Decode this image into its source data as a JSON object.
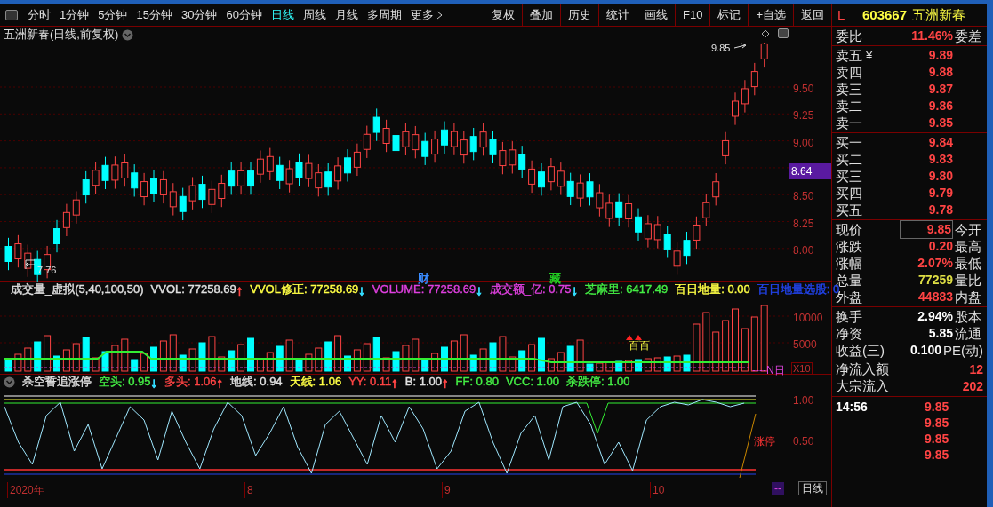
{
  "toolbar": {
    "periods": [
      {
        "label": "分时",
        "selected": false
      },
      {
        "label": "1分钟",
        "selected": false
      },
      {
        "label": "5分钟",
        "selected": false
      },
      {
        "label": "15分钟",
        "selected": false
      },
      {
        "label": "30分钟",
        "selected": false
      },
      {
        "label": "60分钟",
        "selected": false
      },
      {
        "label": "日线",
        "selected": true
      },
      {
        "label": "周线",
        "selected": false
      },
      {
        "label": "月线",
        "selected": false
      },
      {
        "label": "多周期",
        "selected": false
      }
    ],
    "more": "更多",
    "buttons": [
      "复权",
      "叠加",
      "历史",
      "统计",
      "画线",
      "F10",
      "标记",
      "+自选",
      "返回"
    ]
  },
  "main_chart": {
    "title": "五洲新春(日线,前复权)",
    "price_labels": [
      "9.50",
      "9.25",
      "9.00",
      "8.50",
      "8.25",
      "8.00"
    ],
    "current_price": "8.64",
    "high_marker": "9.85",
    "low_marker": "7.76",
    "signals": [
      {
        "text": "财",
        "color": "#3a8cff"
      },
      {
        "text": "藏",
        "color": "#22cc22"
      }
    ]
  },
  "volume_panel": {
    "legend": [
      {
        "text": "成交量_虚拟(5,40,100,50)",
        "color": "#e0e0e0"
      },
      {
        "text": "VVOL: 77258.69",
        "color": "#e0e0e0",
        "arrow": {
          "text": "↑",
          "color": "#ff4444"
        }
      },
      {
        "text": "VVOL修正: 77258.69",
        "color": "#ffff44",
        "arrow": {
          "text": "↓",
          "color": "#33ddff"
        }
      },
      {
        "text": "VOLUME: 77258.69",
        "color": "#e040e0",
        "arrow": {
          "text": "↓",
          "color": "#33ddff"
        }
      },
      {
        "text": "成交额_亿: 0.75",
        "color": "#e040e0",
        "arrow": {
          "text": "↓",
          "color": "#33ddff"
        }
      },
      {
        "text": "芝麻里: 6417.49",
        "color": "#44ee44"
      },
      {
        "text": "百日地量: 0.00",
        "color": "#ffff44"
      },
      {
        "text": "百日地量选股: 0",
        "color": "#2244ee"
      }
    ],
    "axis_labels": [
      "10000",
      "5000"
    ],
    "bottom_mark": "百百",
    "line_label": "----N日",
    "scale_label": "X10"
  },
  "indicator_panel": {
    "legend": [
      {
        "text": "杀空誓追涨停",
        "color": "#e0e0e0"
      },
      {
        "text": "空头: 0.95",
        "color": "#44ee44",
        "arrow": {
          "text": "↓",
          "color": "#33ddff"
        }
      },
      {
        "text": "多头: 1.06",
        "color": "#ff4444",
        "arrow": {
          "text": "↑",
          "color": "#ff4444"
        }
      },
      {
        "text": "地线: 0.94",
        "color": "#e0e0e0"
      },
      {
        "text": "天线: 1.06",
        "color": "#ffff44"
      },
      {
        "text": "YY: 0.11",
        "color": "#ff4444",
        "arrow": {
          "text": "↑",
          "color": "#ff4444"
        }
      },
      {
        "text": "B: 1.00",
        "color": "#e0e0e0",
        "arrow": {
          "text": "↑",
          "color": "#ff4444"
        }
      },
      {
        "text": "FF: 0.80",
        "color": "#44ee44"
      },
      {
        "text": "VCC: 1.00",
        "color": "#44ee44"
      },
      {
        "text": "杀跌停: 1.00",
        "color": "#44ee44"
      }
    ],
    "axis_labels": [
      "1.00",
      "0.50"
    ],
    "signal_label": "涨停"
  },
  "date_axis": {
    "labels": [
      "2020年",
      "8",
      "9",
      "10"
    ],
    "corner_button": "--",
    "period_tab": "日线"
  },
  "quote_panel": {
    "market": "L",
    "code": "603667",
    "name": "五洲新春",
    "ratio": {
      "label": "委比",
      "value": "11.46%",
      "right": "委差"
    },
    "sells": [
      {
        "label": "卖五",
        "tag": "¥",
        "price": "9.89"
      },
      {
        "label": "卖四",
        "price": "9.88"
      },
      {
        "label": "卖三",
        "price": "9.87"
      },
      {
        "label": "卖二",
        "price": "9.86"
      },
      {
        "label": "卖一",
        "price": "9.85"
      }
    ],
    "buys": [
      {
        "label": "买一",
        "price": "9.84"
      },
      {
        "label": "买二",
        "price": "9.83"
      },
      {
        "label": "买三",
        "price": "9.80"
      },
      {
        "label": "买四",
        "price": "9.79"
      },
      {
        "label": "买五",
        "price": "9.78"
      }
    ],
    "stats": [
      {
        "label": "现价",
        "value": "9.85",
        "right": "今开",
        "kind": "up",
        "boxed": true
      },
      {
        "label": "涨跌",
        "value": "0.20",
        "right": "最高",
        "kind": "up",
        "boxed": false
      },
      {
        "label": "涨幅",
        "value": "2.07%",
        "right": "最低",
        "kind": "up",
        "boxed": false
      },
      {
        "label": "总量",
        "value": "77259",
        "right": "量比",
        "kind": "volume",
        "boxed": false
      },
      {
        "label": "外盘",
        "value": "44883",
        "right": "内盘",
        "kind": "up",
        "boxed": false
      }
    ],
    "finance": [
      {
        "label": "换手",
        "value": "2.94%",
        "right": "股本"
      },
      {
        "label": "净资",
        "value": "5.85",
        "right": "流通"
      },
      {
        "label": "收益(三)",
        "value": "0.100",
        "right": "PE(动)"
      }
    ],
    "flows": [
      {
        "label": "净流入额",
        "value": "12"
      },
      {
        "label": "大宗流入",
        "value": "202"
      }
    ],
    "ticks": [
      {
        "time": "14:56",
        "price": "9.85"
      },
      {
        "price": "9.85"
      },
      {
        "price": "9.85"
      },
      {
        "price": "9.85"
      }
    ]
  }
}
